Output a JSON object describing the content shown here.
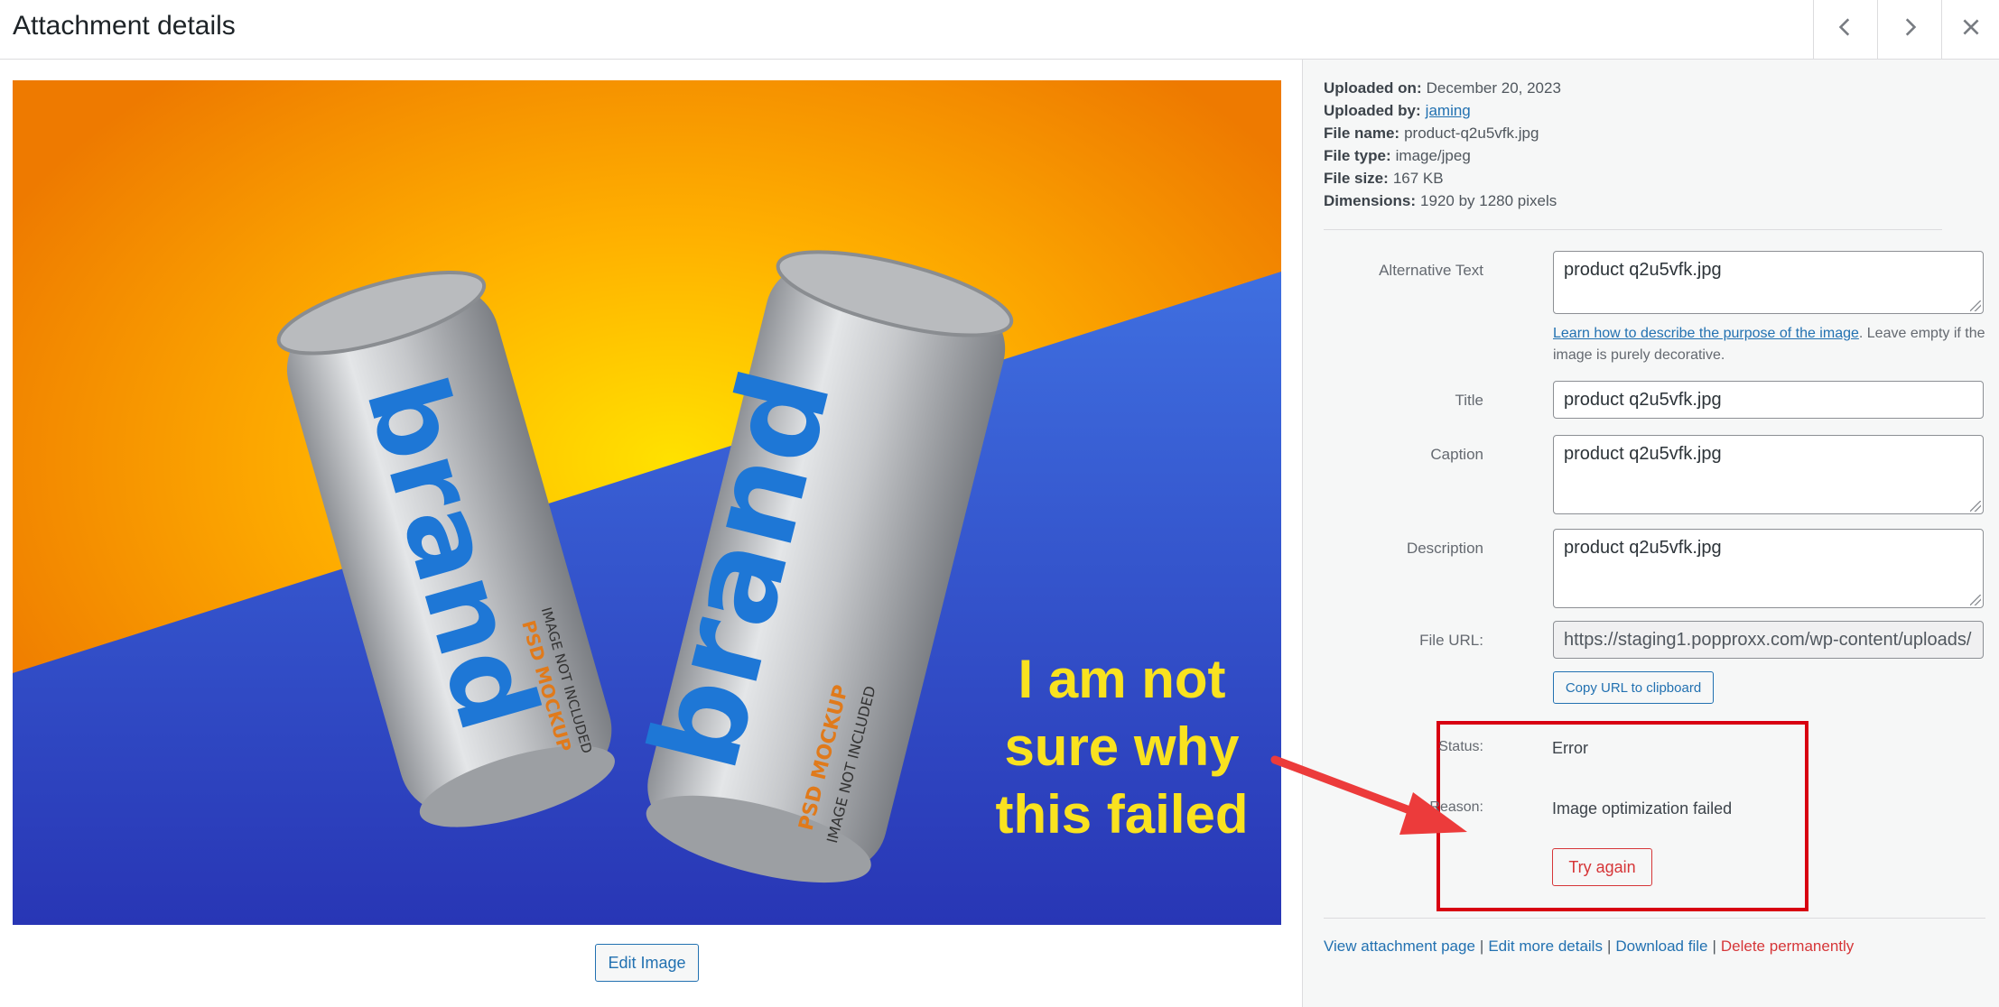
{
  "header": {
    "title": "Attachment details",
    "prev_icon": "chevron-left-icon",
    "next_icon": "chevron-right-icon",
    "close_icon": "close-icon"
  },
  "media": {
    "image_alt": "product q2u5vfk.jpg",
    "can_text_brand": "brand",
    "can_text_mockup": "PSD MOCKUP",
    "can_text_sub": "IMAGE NOT INCLUDED",
    "edit_button": "Edit Image"
  },
  "annotation": {
    "lines": [
      "I am not",
      "sure why",
      "this failed"
    ],
    "color": "#f9e21f"
  },
  "details": {
    "uploaded_on_label": "Uploaded on:",
    "uploaded_on": "December 20, 2023",
    "uploaded_by_label": "Uploaded by:",
    "uploaded_by": "jaming",
    "file_name_label": "File name:",
    "file_name": "product-q2u5vfk.jpg",
    "file_type_label": "File type:",
    "file_type": "image/jpeg",
    "file_size_label": "File size:",
    "file_size": "167 KB",
    "dimensions_label": "Dimensions:",
    "dimensions": "1920 by 1280 pixels"
  },
  "form": {
    "alt_label": "Alternative Text",
    "alt_value": "product q2u5vfk.jpg",
    "alt_help_link": "Learn how to describe the purpose of the image",
    "alt_help_text": ". Leave empty if the image is purely decorative.",
    "title_label": "Title",
    "title_value": "product q2u5vfk.jpg",
    "caption_label": "Caption",
    "caption_value": "product q2u5vfk.jpg",
    "description_label": "Description",
    "description_value": "product q2u5vfk.jpg",
    "url_label": "File URL:",
    "url_value": "https://staging1.popproxx.com/wp-content/uploads/",
    "copy_button": "Copy URL to clipboard"
  },
  "optimization": {
    "status_label": "Status:",
    "status_value": "Error",
    "reason_label": "Reason:",
    "reason_value": "Image optimization failed",
    "retry_button": "Try again",
    "highlight_color": "#d80011"
  },
  "actions": {
    "view": "View attachment page",
    "edit": "Edit more details",
    "download": "Download file",
    "delete": "Delete permanently",
    "separator": "|"
  },
  "colors": {
    "accent": "#2271b1",
    "danger": "#d63638",
    "bg_orange": "#f7a600",
    "bg_blue": "#2f4fd3"
  }
}
